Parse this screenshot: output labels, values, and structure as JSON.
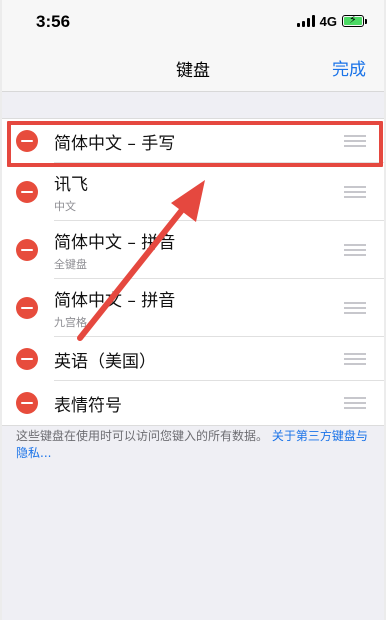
{
  "status_bar": {
    "time": "3:56",
    "network": "4G"
  },
  "nav": {
    "title": "键盘",
    "done_label": "完成"
  },
  "keyboards": [
    {
      "title": "简体中文 – 手写",
      "subtitle": ""
    },
    {
      "title": "讯飞",
      "subtitle": "中文"
    },
    {
      "title": "简体中文 – 拼音",
      "subtitle": "全键盘"
    },
    {
      "title": "简体中文 – 拼音",
      "subtitle": "九宫格"
    },
    {
      "title": "英语（美国）",
      "subtitle": ""
    },
    {
      "title": "表情符号",
      "subtitle": ""
    }
  ],
  "footer": {
    "note": "这些键盘在使用时可以访问您键入的所有数据。",
    "link": "关于第三方键盘与隐私..."
  },
  "icons": {
    "delete": "minus-circle-icon",
    "reorder": "drag-handle-icon",
    "signal": "cellular-signal-icon",
    "battery": "battery-charging-icon"
  },
  "colors": {
    "accent": "#1a73e8",
    "delete": "#e74c3c",
    "annotation": "#e5483f",
    "battery": "#4cd964"
  }
}
